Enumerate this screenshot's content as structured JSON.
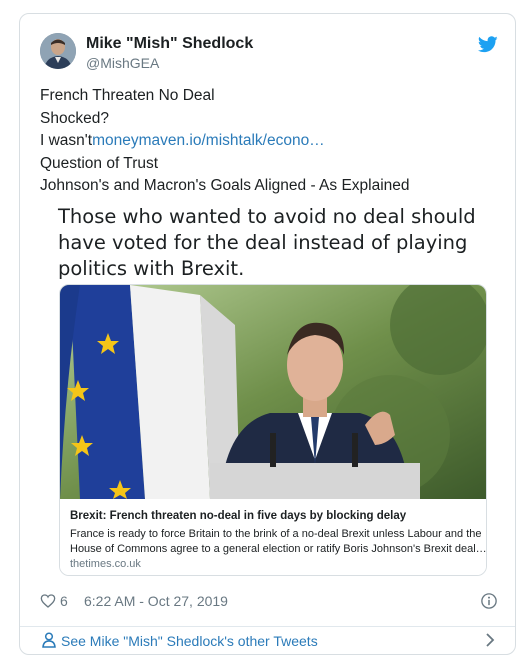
{
  "author": {
    "name": "Mike \"Mish\" Shedlock",
    "handle": "@MishGEA",
    "avatar_icon": "user-avatar"
  },
  "brand": {
    "icon": "twitter-bird-icon",
    "color": "#1da1f2"
  },
  "tweet": {
    "lines": {
      "l1": "French Threaten No Deal",
      "l2": "Shocked?",
      "l3_prefix": "I wasn't",
      "l3_link": "moneymaven.io/mishtalk/econo…",
      "l4": "Question of Trust",
      "l5": "Johnson's and Macron's Goals Aligned - As Explained"
    },
    "quote": {
      "l1": "Those who wanted to avoid no deal should",
      "l2": "have voted for the deal instead of playing",
      "l3": "politics with Brexit."
    }
  },
  "card": {
    "title": "Brexit: French threaten no-deal in five days by blocking delay",
    "desc1": "France is ready to force Britain to the brink of a no-deal Brexit unless Labour and the",
    "desc2": "House of Commons agree to a general election or ratify Boris Johnson's Brexit deal…",
    "domain": "thetimes.co.uk"
  },
  "actions": {
    "likes": "6",
    "timestamp": "6:22 AM - Oct 27, 2019"
  },
  "footer": {
    "label": "See Mike \"Mish\" Shedlock's other Tweets"
  },
  "colors": {
    "link": "#2b7bb9",
    "muted": "#697882",
    "border": "#d8dee2"
  }
}
